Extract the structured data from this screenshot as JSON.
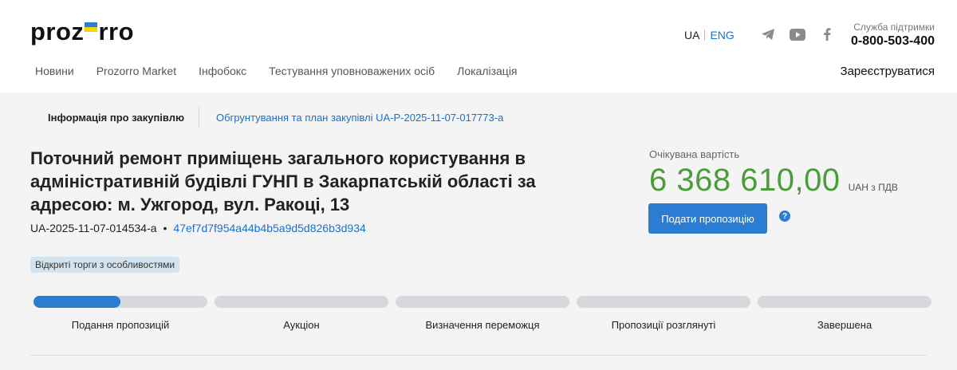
{
  "header": {
    "logo": {
      "left": "proz",
      "right": "rro"
    },
    "lang": {
      "ua": "UA",
      "en": "ENG"
    },
    "social": [
      "telegram-icon",
      "youtube-icon",
      "facebook-icon"
    ],
    "support": {
      "label": "Служба підтримки",
      "phone": "0-800-503-400"
    },
    "nav": [
      "Новини",
      "Prozorro Market",
      "Інфобокс",
      "Тестування уповноважених осіб",
      "Локалізація"
    ],
    "register": "Зареєструватися"
  },
  "tabs": {
    "active": "Інформація про закупівлю",
    "link": "Обгрунтування та план закупівлі UA-P-2025-11-07-017773-a"
  },
  "tender": {
    "title": "Поточний ремонт приміщень загального користування в адміністративній будівлі ГУНП в Закарпатській області за адресою: м. Ужгород, вул. Ракоці, 13",
    "id": "UA-2025-11-07-014534-a",
    "separator": "•",
    "hash": "47ef7d7f954a44b4b5a9d5d826b3d934",
    "badge": "Відкриті торги з особливостями"
  },
  "value": {
    "label": "Очікувана вартість",
    "amount": "6 368 610,00",
    "currency": "UAH з ПДВ",
    "submit": "Подати пропозицію",
    "help": "?"
  },
  "colors": {
    "accent": "#2b7cd3",
    "amount": "#4a9e3a",
    "badge": "#d3e4f0"
  },
  "stages": [
    {
      "label": "Подання пропозицій",
      "progress": 0.5
    },
    {
      "label": "Аукціон",
      "progress": 0
    },
    {
      "label": "Визначення переможця",
      "progress": 0
    },
    {
      "label": "Пропозиції розглянуті",
      "progress": 0
    },
    {
      "label": "Завершена",
      "progress": 0
    }
  ]
}
